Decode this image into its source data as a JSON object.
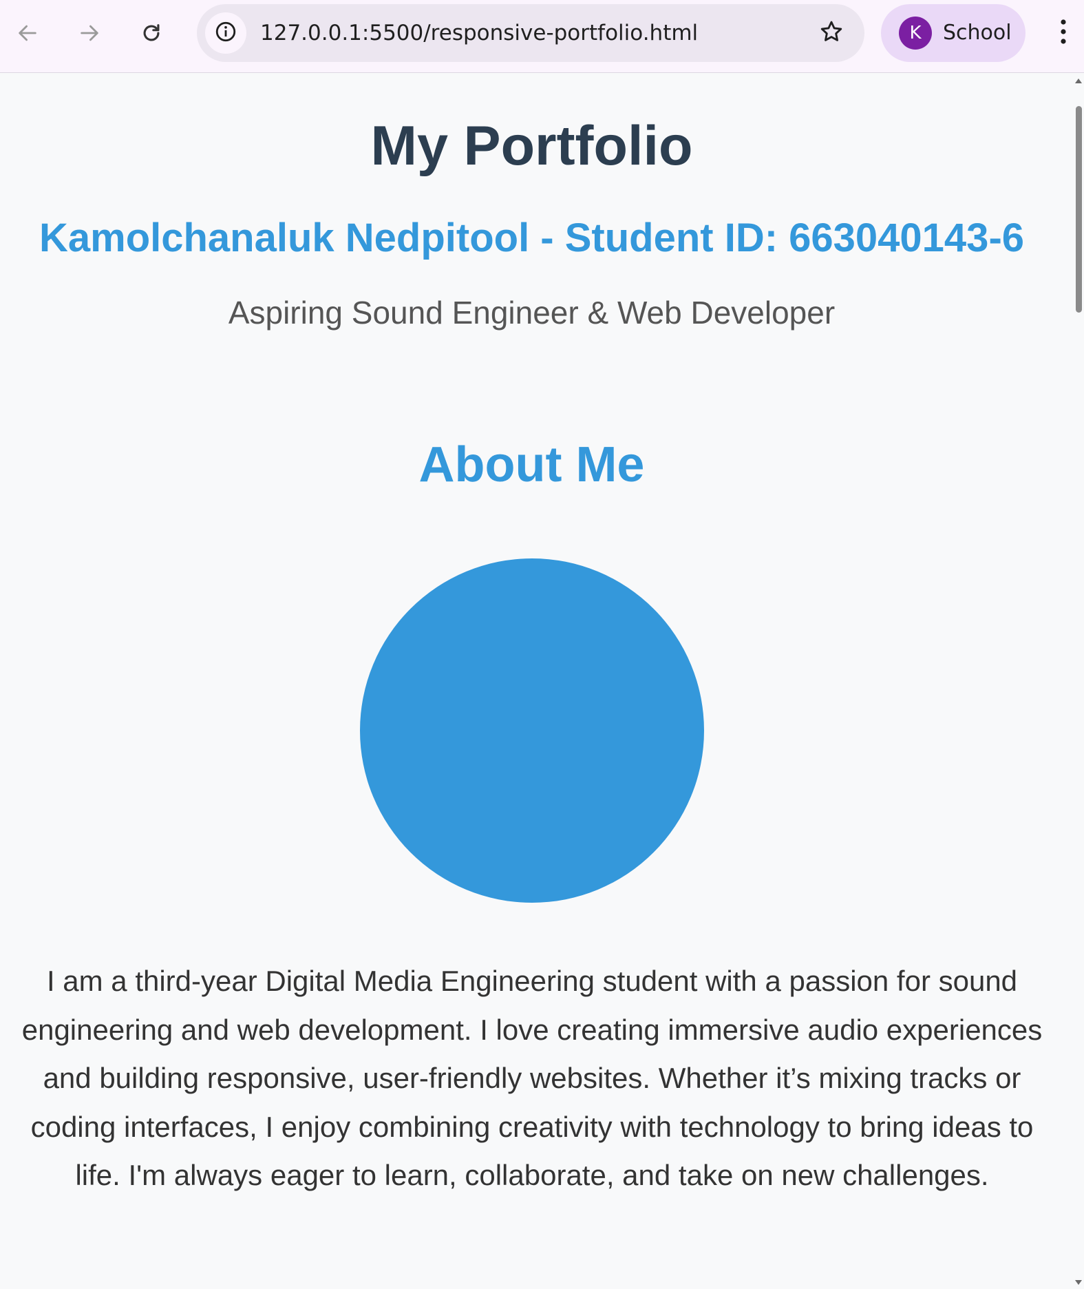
{
  "browser": {
    "url": "127.0.0.1:5500/responsive-portfolio.html",
    "profile": {
      "initial": "K",
      "name": "School"
    }
  },
  "page": {
    "title": "My Portfolio",
    "subtitle": "Kamolchanaluk Nedpitool - Student ID: 663040143-6",
    "tagline": "Aspiring Sound Engineer & Web Developer",
    "about": {
      "heading": "About Me",
      "text": "I am a third-year Digital Media Engineering student with a passion for sound engineering and web development. I love creating immersive audio experiences and building responsive, user-friendly websites. Whether it’s mixing tracks or coding interfaces, I enjoy combining creativity with technology to bring ideas to life. I'm always eager to learn, collaborate, and take on new challenges."
    }
  },
  "colors": {
    "accent": "#3498db",
    "title": "#2c3e50",
    "background": "#f8f9fa",
    "avatar": "#7b1fa2"
  }
}
